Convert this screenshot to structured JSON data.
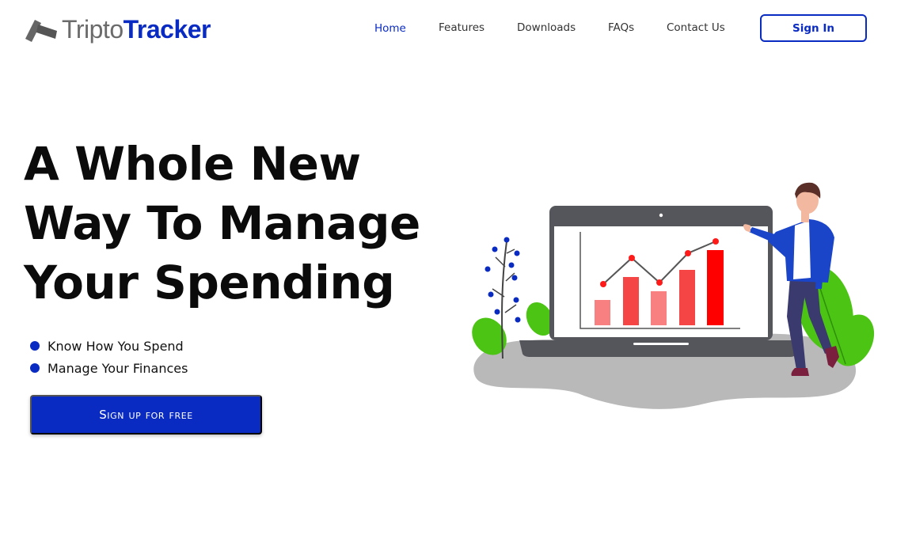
{
  "brand": {
    "name_light": "Tripto",
    "name_bold": "Tracker",
    "accent_color": "#0a2bc2"
  },
  "nav": {
    "items": [
      {
        "label": "Home",
        "active": true
      },
      {
        "label": "Features",
        "active": false
      },
      {
        "label": "Downloads",
        "active": false
      },
      {
        "label": "FAQs",
        "active": false
      },
      {
        "label": "Contact Us",
        "active": false
      }
    ],
    "signin_label": "Sign In"
  },
  "hero": {
    "headline_lines": [
      "A Whole New",
      "Way To Manage",
      "Your Spending"
    ],
    "bullets": [
      "Know How You Spend",
      "Manage Your Finances"
    ],
    "cta_label": "Sign up for free"
  },
  "illustration": {
    "description_icon": "laptop-analytics-chart-icon"
  }
}
